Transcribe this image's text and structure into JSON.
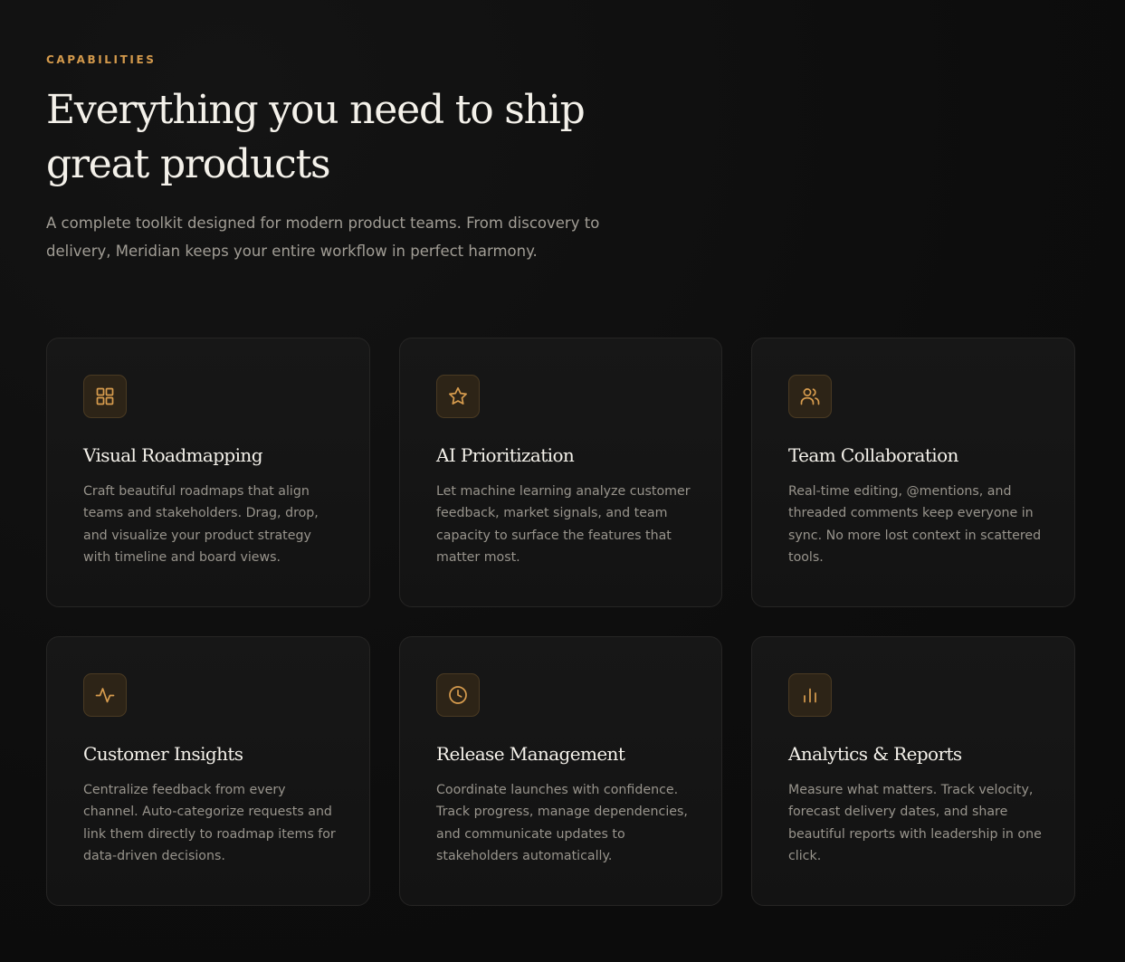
{
  "section": {
    "eyebrow": "CAPABILITIES",
    "headline": "Everything you need to ship great products",
    "lede": "A complete toolkit designed for modern product teams. From discovery to delivery, Meridian keeps your entire workflow in perfect harmony."
  },
  "colors": {
    "accent": "#d49a4c",
    "background": "#0e0e0e",
    "card": "#151515",
    "icon_bg": "#2d2417"
  },
  "features": [
    {
      "icon": "grid-icon",
      "title": "Visual Roadmapping",
      "description": "Craft beautiful roadmaps that align teams and stakeholders. Drag, drop, and visualize your product strategy with timeline and board views."
    },
    {
      "icon": "star-icon",
      "title": "AI Prioritization",
      "description": "Let machine learning analyze customer feedback, market signals, and team capacity to surface the features that matter most."
    },
    {
      "icon": "users-icon",
      "title": "Team Collaboration",
      "description": "Real-time editing, @mentions, and threaded comments keep everyone in sync. No more lost context in scattered tools."
    },
    {
      "icon": "activity-icon",
      "title": "Customer Insights",
      "description": "Centralize feedback from every channel. Auto-categorize requests and link them directly to roadmap items for data-driven decisions."
    },
    {
      "icon": "clock-icon",
      "title": "Release Management",
      "description": "Coordinate launches with confidence. Track progress, manage dependencies, and communicate updates to stakeholders automatically."
    },
    {
      "icon": "bar-chart-icon",
      "title": "Analytics & Reports",
      "description": "Measure what matters. Track velocity, forecast delivery dates, and share beautiful reports with leadership in one click."
    }
  ]
}
